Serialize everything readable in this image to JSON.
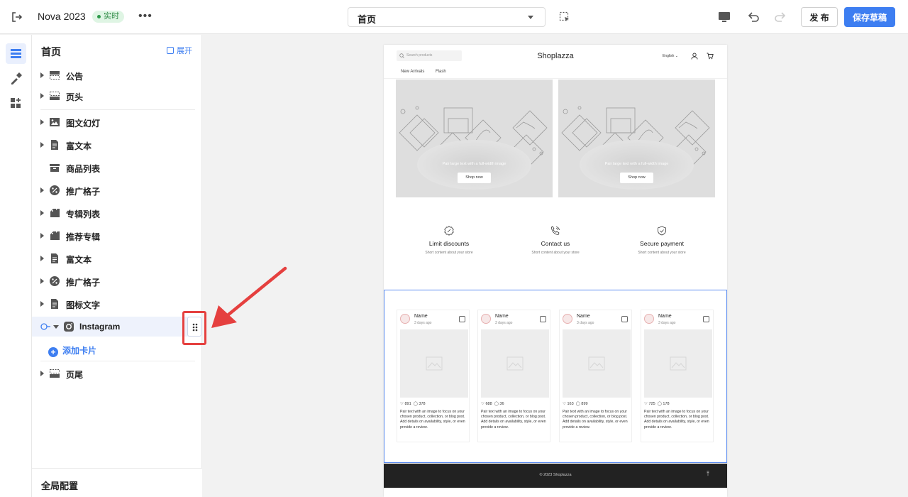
{
  "topbar": {
    "title": "Nova 2023",
    "status_badge": "实时",
    "more_label": "•••",
    "page_select": "首页",
    "publish_label": "发 布",
    "save_draft_label": "保存草稿"
  },
  "panel": {
    "title": "首页",
    "expand_label": "展开",
    "items": [
      {
        "label": "公告",
        "icon": "announcement-icon"
      },
      {
        "label": "页头",
        "icon": "header-icon"
      },
      {
        "label": "图文幻灯",
        "icon": "image-slideshow-icon"
      },
      {
        "label": "富文本",
        "icon": "rich-text-icon"
      },
      {
        "label": "商品列表",
        "icon": "product-list-icon"
      },
      {
        "label": "推广格子",
        "icon": "promo-grid-icon"
      },
      {
        "label": "专辑列表",
        "icon": "collection-list-icon"
      },
      {
        "label": "推荐专辑",
        "icon": "featured-collection-icon"
      },
      {
        "label": "富文本",
        "icon": "rich-text-icon"
      },
      {
        "label": "推广格子",
        "icon": "promo-grid-icon"
      },
      {
        "label": "图标文字",
        "icon": "icon-text-icon"
      },
      {
        "label": "Instagram",
        "icon": "instagram-icon"
      },
      {
        "label": "页尾",
        "icon": "footer-icon"
      }
    ],
    "add_card_label": "添加卡片",
    "global_config_label": "全局配置"
  },
  "store": {
    "search_placeholder": "Search products",
    "logo": "Shoplazza",
    "language": "English",
    "nav": [
      "New Arrivals",
      "Flash"
    ],
    "banner_text": "Pair large text with a full-width image",
    "banner_button": "Shop now",
    "features": [
      {
        "title": "Limit discounts",
        "subtitle": "Short content about your store"
      },
      {
        "title": "Contact us",
        "subtitle": "Short content about your store"
      },
      {
        "title": "Secure payment",
        "subtitle": "Short content about your store"
      }
    ],
    "instagram_posts": [
      {
        "name": "Name",
        "date": "3 days ago",
        "likes": "891",
        "comments": "378"
      },
      {
        "name": "Name",
        "date": "3 days ago",
        "likes": "688",
        "comments": "36"
      },
      {
        "name": "Name",
        "date": "3 days ago",
        "likes": "163",
        "comments": "899"
      },
      {
        "name": "Name",
        "date": "3 days ago",
        "likes": "725",
        "comments": "178"
      }
    ],
    "post_caption": "Pair text with an image to focus on your chosen product, collection, or blog post. Add details on availability, style, or even provide a review.",
    "footer_copyright": "© 2023 Shoplazza",
    "back_to_top": "⤒"
  },
  "colors": {
    "accent": "#3d7ef1",
    "live_green": "#2e9a4a",
    "annotation_red": "#e5403f"
  }
}
